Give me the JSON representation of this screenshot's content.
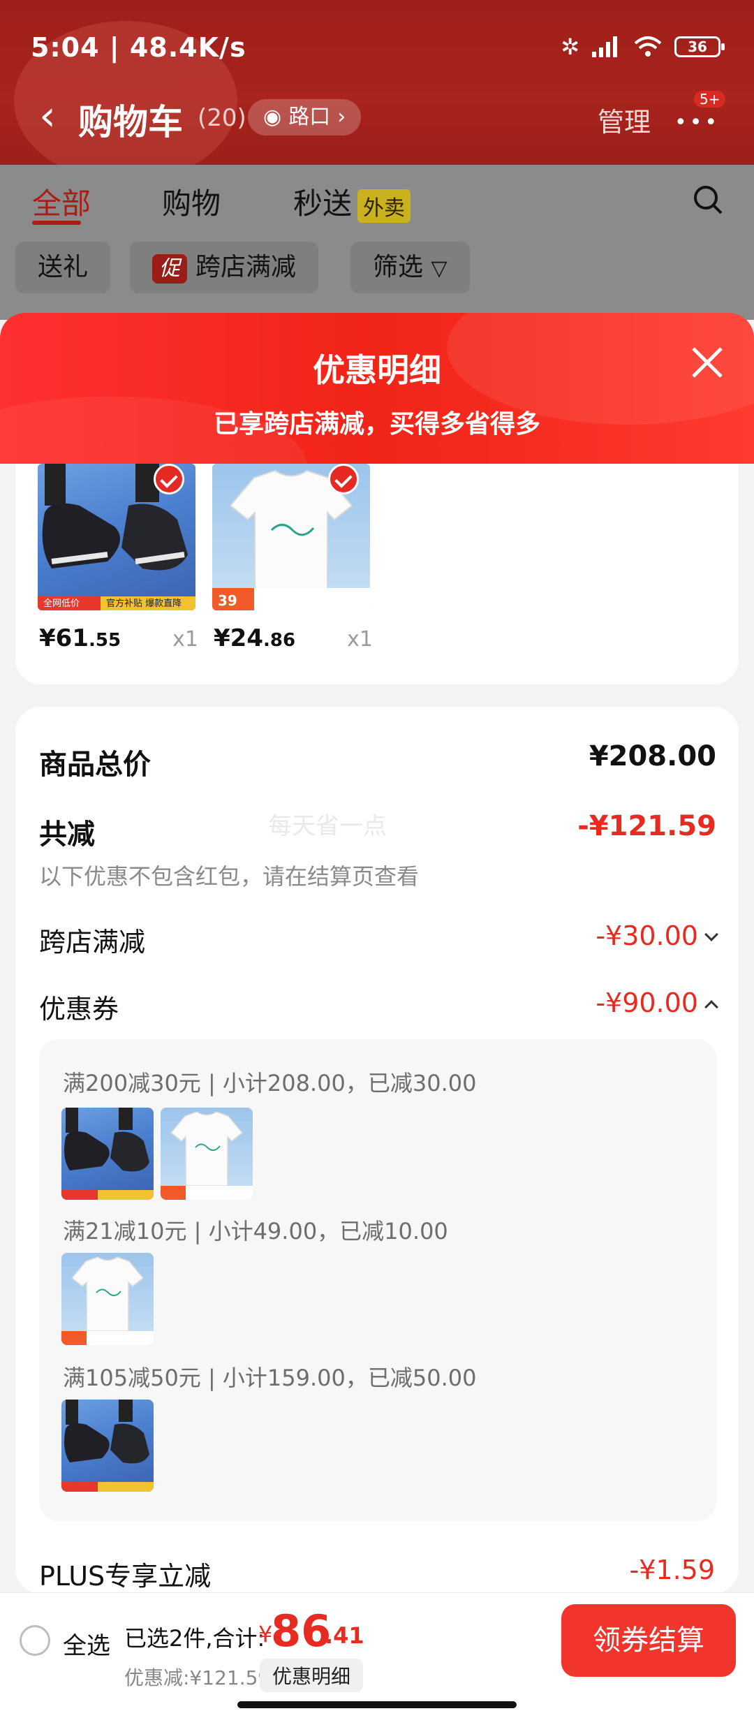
{
  "status_bar": {
    "time": "5:04 | 48.4K/s",
    "battery": "36"
  },
  "nav": {
    "title": "购物车",
    "count": "(20)",
    "location": "路口",
    "manage": "管理",
    "more_badge": "5+"
  },
  "tabs": [
    {
      "label": "全部"
    },
    {
      "label": "购物"
    },
    {
      "label": "秒送",
      "tag": "外卖"
    }
  ],
  "chips": [
    {
      "label": "送礼"
    },
    {
      "tag": "促",
      "label": "跨店满减"
    },
    {
      "label": "筛选"
    }
  ],
  "sheet": {
    "title": "优惠明细",
    "subtitle": "已享跨店满减，买得多省得多"
  },
  "products": [
    {
      "price_int": "¥61",
      "price_dec": ".55",
      "qty": "x1",
      "badge_left": "全网低价",
      "badge_right": "官方补贴 爆款直降"
    },
    {
      "price_int": "¥24",
      "price_dec": ".86",
      "qty": "x1",
      "badge_left": "39"
    }
  ],
  "summary": {
    "total_label": "商品总价",
    "total_value": "¥208.00",
    "reduce_label": "共减",
    "reduce_value": "-¥121.59",
    "note": "以下优惠不包含红包，请在结算页查看",
    "watermark": "每天省一点",
    "cross_store_label": "跨店满减",
    "cross_store_value": "-¥30.00",
    "coupon_label": "优惠券",
    "coupon_value": "-¥90.00",
    "coupon_groups": [
      {
        "text": "满200减30元 | 小计208.00，已减30.00"
      },
      {
        "text": "满21减10元 | 小计49.00，已减10.00"
      },
      {
        "text": "满105减50元 | 小计159.00，已减50.00"
      }
    ],
    "plus_label": "PLUS专享立减",
    "plus_value": "-¥1.59"
  },
  "bottom": {
    "select_all": "全选",
    "selected_summary": "已选2件,合计:",
    "currency": "¥",
    "total_int": "86",
    "total_dec": ".41",
    "discount": "优惠减:¥121.59",
    "detail_button": "优惠明细",
    "checkout": "领券结算"
  },
  "colors": {
    "accent_red": "#e82b21",
    "header_red": "#a8241c",
    "checkout_red": "#f1352d"
  }
}
